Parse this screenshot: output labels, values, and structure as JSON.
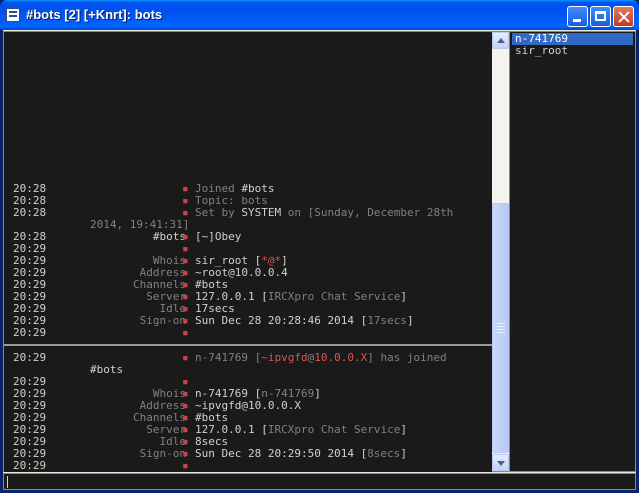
{
  "window": {
    "title": "#bots [2] [+Knrt]: bots",
    "minimize_icon": "minimize-icon",
    "maximize_icon": "maximize-icon",
    "close_icon": "close-icon"
  },
  "top_pane": {
    "lines": [
      {
        "ts": "20:28",
        "nick": "",
        "bullet": "▪",
        "parts": [
          {
            "t": "Joined ",
            "c": "dim"
          },
          {
            "t": "#bots",
            "c": ""
          }
        ]
      },
      {
        "ts": "20:28",
        "nick": "",
        "bullet": "▪",
        "parts": [
          {
            "t": "Topic: bots",
            "c": "dim"
          }
        ]
      },
      {
        "ts": "20:28",
        "nick": "",
        "bullet": "▪",
        "parts": [
          {
            "t": "Set by ",
            "c": "dim"
          },
          {
            "t": "SYSTEM",
            "c": ""
          },
          {
            "t": " on [",
            "c": "dim"
          },
          {
            "t": "Sunday, December 28th",
            "c": "dim"
          }
        ]
      },
      {
        "ts": "",
        "nick": "",
        "bullet": "",
        "wrap": "2014, 19:41:31]"
      },
      {
        "ts": "20:28",
        "nick": "#bots",
        "bullet": "▪",
        "parts": [
          {
            "t": "[~]Obey",
            "c": ""
          }
        ]
      },
      {
        "ts": "20:29",
        "nick": "",
        "bullet": "▪",
        "parts": []
      },
      {
        "ts": "20:29",
        "nick": "Whois",
        "bullet": "▪",
        "parts": [
          {
            "t": "sir_root [",
            "c": ""
          },
          {
            "t": "*@*",
            "c": "red"
          },
          {
            "t": "]",
            "c": ""
          }
        ]
      },
      {
        "ts": "20:29",
        "nick": "Address",
        "bullet": "▪",
        "parts": [
          {
            "t": "~root@10.0.0.4",
            "c": ""
          }
        ]
      },
      {
        "ts": "20:29",
        "nick": "Channels",
        "bullet": "▪",
        "parts": [
          {
            "t": "#bots",
            "c": ""
          }
        ]
      },
      {
        "ts": "20:29",
        "nick": "Server",
        "bullet": "▪",
        "parts": [
          {
            "t": "127.0.0.1 [",
            "c": ""
          },
          {
            "t": "IRCXpro Chat Service",
            "c": "dim"
          },
          {
            "t": "]",
            "c": ""
          }
        ]
      },
      {
        "ts": "20:29",
        "nick": "Idle",
        "bullet": "▪",
        "parts": [
          {
            "t": "17secs",
            "c": ""
          }
        ]
      },
      {
        "ts": "20:29",
        "nick": "Sign-on",
        "bullet": "▪",
        "parts": [
          {
            "t": "Sun Dec 28 20:28:46 2014 [",
            "c": ""
          },
          {
            "t": "17secs",
            "c": "dim"
          },
          {
            "t": "]",
            "c": ""
          }
        ]
      },
      {
        "ts": "20:29",
        "nick": "",
        "bullet": "▪",
        "parts": []
      }
    ]
  },
  "bottom_pane": {
    "lines": [
      {
        "ts": "20:29",
        "nick": "",
        "bullet": "▪",
        "parts": [
          {
            "t": "n-741769 [",
            "c": "dim"
          },
          {
            "t": "~ipvgfd",
            "c": "red"
          },
          {
            "t": "@",
            "c": "dim"
          },
          {
            "t": "10.0.0.X",
            "c": "red"
          },
          {
            "t": "] has joined",
            "c": "dim"
          }
        ]
      },
      {
        "ts": "",
        "nick": "",
        "bullet": "",
        "wrap": "#bots",
        "wrap_bright": true
      },
      {
        "ts": "20:29",
        "nick": "",
        "bullet": "▪",
        "parts": []
      },
      {
        "ts": "20:29",
        "nick": "Whois",
        "bullet": "▪",
        "parts": [
          {
            "t": "n-741769 [",
            "c": ""
          },
          {
            "t": "n-741769",
            "c": "dim"
          },
          {
            "t": "]",
            "c": ""
          }
        ]
      },
      {
        "ts": "20:29",
        "nick": "Address",
        "bullet": "▪",
        "parts": [
          {
            "t": "~ipvgfd@10.0.0.X",
            "c": ""
          }
        ]
      },
      {
        "ts": "20:29",
        "nick": "Channels",
        "bullet": "▪",
        "parts": [
          {
            "t": "#bots",
            "c": ""
          }
        ]
      },
      {
        "ts": "20:29",
        "nick": "Server",
        "bullet": "▪",
        "parts": [
          {
            "t": "127.0.0.1 [",
            "c": ""
          },
          {
            "t": "IRCXpro Chat Service",
            "c": "dim"
          },
          {
            "t": "]",
            "c": ""
          }
        ]
      },
      {
        "ts": "20:29",
        "nick": "Idle",
        "bullet": "▪",
        "parts": [
          {
            "t": "8secs",
            "c": ""
          }
        ]
      },
      {
        "ts": "20:29",
        "nick": "Sign-on",
        "bullet": "▪",
        "parts": [
          {
            "t": "Sun Dec 28 20:29:50 2014 [",
            "c": ""
          },
          {
            "t": "8secs",
            "c": "dim"
          },
          {
            "t": "]",
            "c": ""
          }
        ]
      },
      {
        "ts": "20:29",
        "nick": "",
        "bullet": "▪",
        "parts": []
      }
    ]
  },
  "userlist": {
    "users": [
      {
        "name": "n-741769",
        "selected": true
      },
      {
        "name": "sir_root",
        "selected": false
      }
    ]
  },
  "input": {
    "value": ""
  }
}
